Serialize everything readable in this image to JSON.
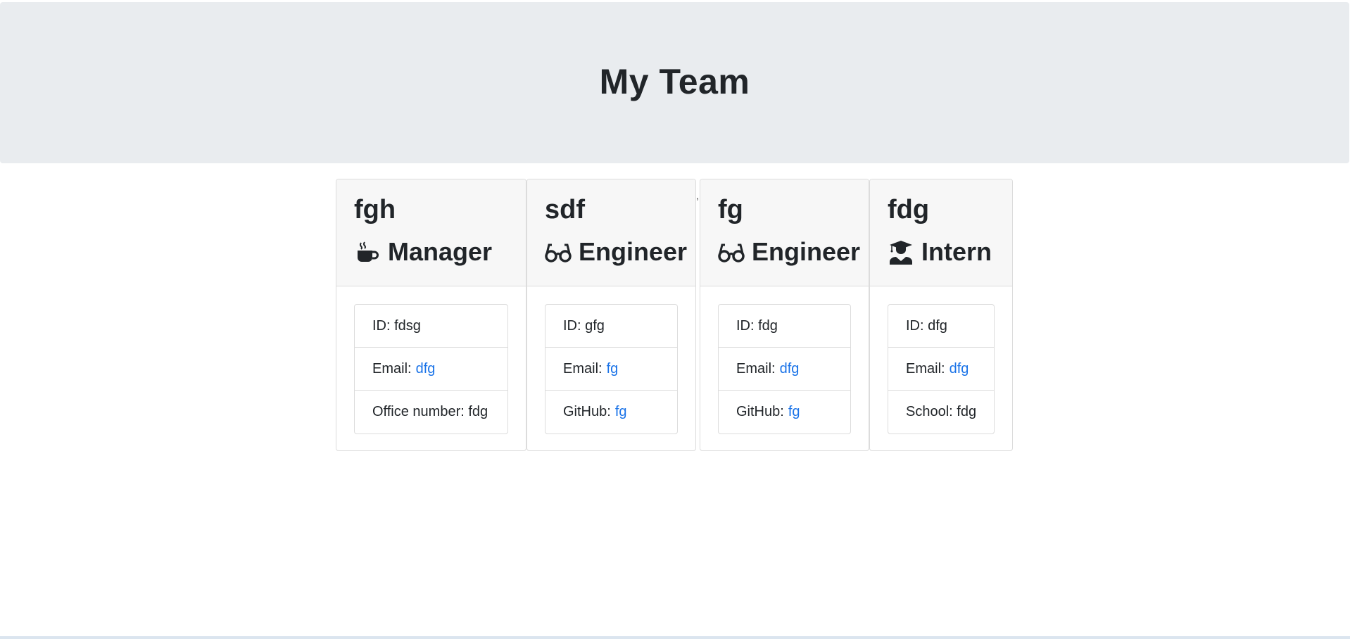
{
  "header": {
    "title": "My Team"
  },
  "cards": [
    {
      "name": "fgh",
      "role": "Manager",
      "icon": "coffee-mug-icon",
      "id_label": "ID:",
      "id_value": "fdsg",
      "email_label": "Email:",
      "email_value": "dfg",
      "extra_label": "Office number:",
      "extra_value": "fdg"
    },
    {
      "name": "sdf",
      "role": "Engineer",
      "icon": "glasses-icon",
      "id_label": "ID:",
      "id_value": "gfg",
      "email_label": "Email:",
      "email_value": "fg",
      "extra_label": "GitHub:",
      "extra_value": "fg"
    },
    {
      "name": "fg",
      "role": "Engineer",
      "icon": "glasses-icon",
      "id_label": "ID:",
      "id_value": "fdg",
      "email_label": "Email:",
      "email_value": "dfg",
      "extra_label": "GitHub:",
      "extra_value": "fg"
    },
    {
      "name": "fdg",
      "role": "Intern",
      "icon": "graduate-icon",
      "id_label": "ID:",
      "id_value": "dfg",
      "email_label": "Email:",
      "email_value": "dfg",
      "extra_label": "School:",
      "extra_value": "fdg"
    }
  ],
  "stray_mark": ",",
  "colors": {
    "jumbotron_bg": "#e9ecef",
    "card_header_bg": "#f7f7f7",
    "link": "#1a73e8",
    "text": "#212529"
  }
}
